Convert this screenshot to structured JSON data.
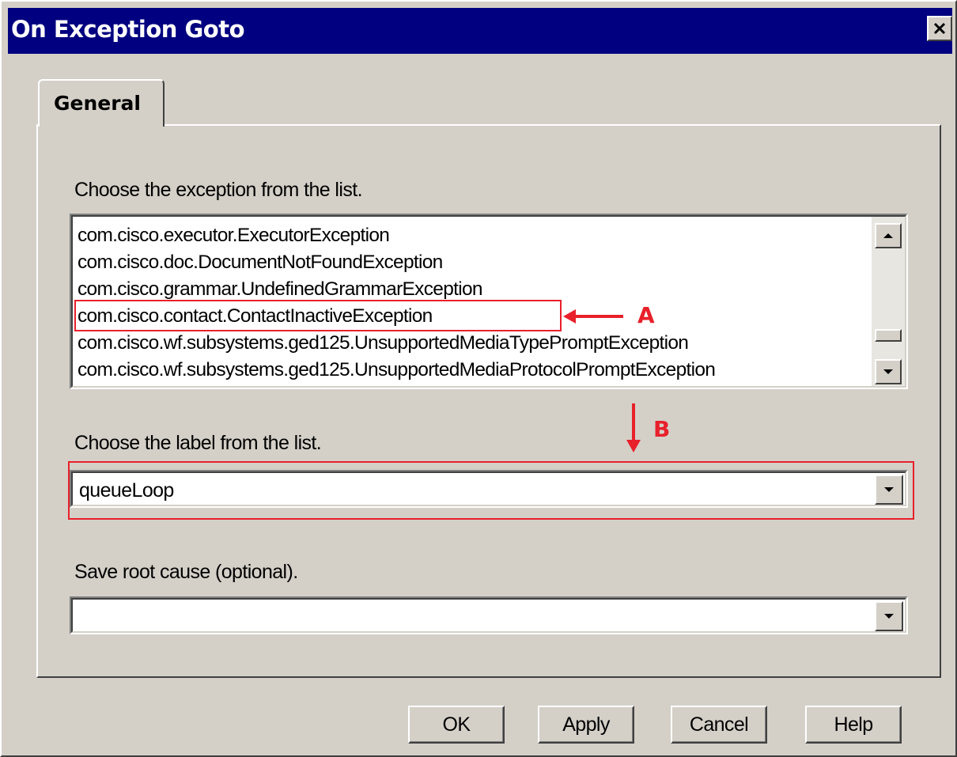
{
  "window": {
    "title": "On Exception Goto",
    "close_label": "✕"
  },
  "tabs": [
    {
      "label": "General"
    }
  ],
  "exception_section": {
    "label": "Choose the exception from the list.",
    "items": [
      "com.cisco.executor.ExecutorException",
      "com.cisco.doc.DocumentNotFoundException",
      "com.cisco.grammar.UndefinedGrammarException",
      "com.cisco.contact.ContactInactiveException",
      "com.cisco.wf.subsystems.ged125.UnsupportedMediaTypePromptException",
      "com.cisco.wf.subsystems.ged125.UnsupportedMediaProtocolPromptException"
    ],
    "highlighted_index": 3
  },
  "label_section": {
    "label": "Choose the label from the list.",
    "value": "queueLoop"
  },
  "root_cause_section": {
    "label": "Save root cause (optional).",
    "value": ""
  },
  "annotations": {
    "a_label": "A",
    "b_label": "B",
    "color": "#e8202a"
  },
  "buttons": {
    "ok": "OK",
    "apply": "Apply",
    "cancel": "Cancel",
    "help": "Help"
  },
  "colors": {
    "titlebar": "#000080",
    "dialog_face": "#d4d0c8"
  }
}
